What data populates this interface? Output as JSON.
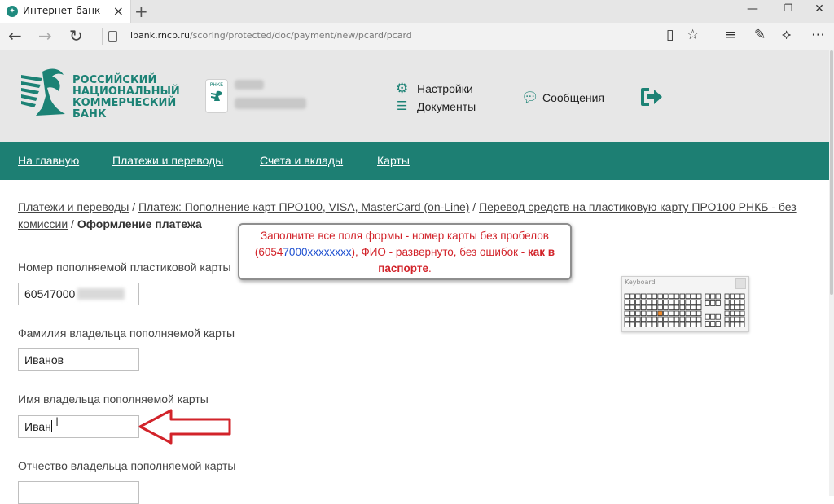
{
  "browser": {
    "tab_title": "Интернет-банк",
    "url_host": "ibank.rncb.ru",
    "url_path": "/scoring/protected/doc/payment/new/pcard/pcard"
  },
  "header": {
    "logo_lines": [
      "РОССИЙСКИЙ",
      "НАЦИОНАЛЬНЫЙ",
      "КОММЕРЧЕСКИЙ",
      "БАНК"
    ],
    "badge": "РНКБ",
    "settings": "Настройки",
    "documents": "Документы",
    "messages": "Сообщения"
  },
  "nav": {
    "home": "На главную",
    "payments": "Платежи и переводы",
    "accounts": "Счета и вклады",
    "cards": "Карты"
  },
  "breadcrumb": {
    "crumb1": "Платежи и переводы",
    "sep": " / ",
    "crumb2": "Платеж: Пополнение карт ПРО100, VISA, MasterCard (on-Line)",
    "crumb3": "Перевод средств на пластиковую карту ПРО100 РНКБ - без комиссии",
    "current": "Оформление платежа"
  },
  "form": {
    "card_label": "Номер пополняемой пластиковой карты",
    "card_value": "60547000",
    "surname_label": "Фамилия владельца пополняемой карты",
    "surname_value": "Иванов",
    "name_label": "Имя владельца пополняемой карты",
    "name_value": "Иван",
    "patronymic_label": "Отчество владельца пополняемой карты",
    "patronymic_value": ""
  },
  "callout": {
    "part1": "Заполните все поля формы - номер карты без пробелов",
    "open_paren": "(",
    "prefix_red": "6054",
    "prefix_blue": "7000",
    "mask": "xxxxxxxx",
    "part2": "), ФИО - развернуто, без ошибок - ",
    "emphasis": "как в паспорте",
    "period": "."
  },
  "keyboard": {
    "title": "Keyboard"
  },
  "colors": {
    "brand_green": "#1d7f73",
    "callout_red": "#d2232a",
    "callout_blue": "#1d4fd0",
    "arrow_red": "#d2232a"
  }
}
